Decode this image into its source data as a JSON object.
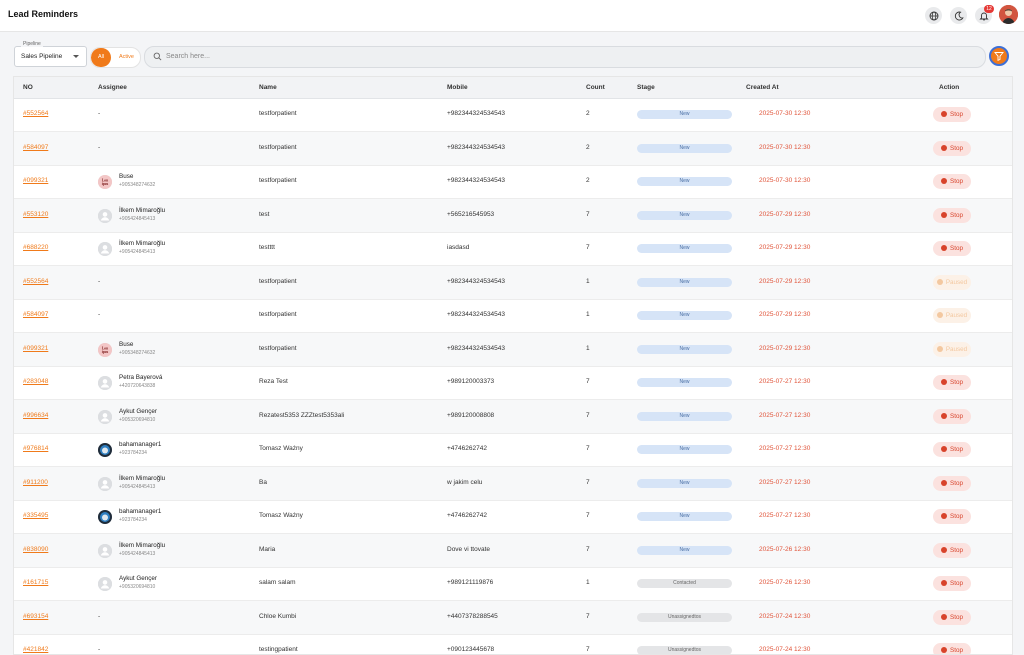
{
  "header": {
    "title": "Lead Reminders",
    "notification_count": "12"
  },
  "filters": {
    "pipeline_label": "Pipeline",
    "pipeline_value": "Sales Pipeline",
    "toggle_all": "All",
    "toggle_active": "Active",
    "search_placeholder": "Search here..."
  },
  "table": {
    "columns": {
      "no": "NO",
      "assignee": "Assignee",
      "name": "Name",
      "mobile": "Mobile",
      "count": "Count",
      "stage": "Stage",
      "created": "Created At",
      "action": "Action"
    },
    "rows": [
      {
        "no": "#552564",
        "assignee": "-",
        "name": "testforpatient",
        "mobile": "+982344324534543",
        "count": "2",
        "stage": "New",
        "created": "2025-07-30 12:30",
        "action": "Stop"
      },
      {
        "no": "#584097",
        "assignee": "-",
        "name": "testforpatient",
        "mobile": "+982344324534543",
        "count": "2",
        "stage": "New",
        "created": "2025-07-30 12:30",
        "action": "Stop"
      },
      {
        "no": "#099321",
        "assignee": "Buse",
        "phone": "+905348274632",
        "avatar": "logo",
        "name": "testforpatient",
        "mobile": "+982344324534543",
        "count": "2",
        "stage": "New",
        "created": "2025-07-30 12:30",
        "action": "Stop"
      },
      {
        "no": "#553120",
        "assignee": "İlkem Mimaroğlu",
        "phone": "+905424845413",
        "avatar": "default",
        "name": "test",
        "mobile": "+565216545953",
        "count": "7",
        "stage": "New",
        "created": "2025-07-29 12:30",
        "action": "Stop"
      },
      {
        "no": "#688220",
        "assignee": "İlkem Mimaroğlu",
        "phone": "+905424845413",
        "avatar": "default",
        "name": "testttt",
        "mobile": "iasdasd",
        "count": "7",
        "stage": "New",
        "created": "2025-07-29 12:30",
        "action": "Stop"
      },
      {
        "no": "#552564",
        "assignee": "-",
        "name": "testforpatient",
        "mobile": "+982344324534543",
        "count": "1",
        "stage": "New",
        "created": "2025-07-29 12:30",
        "action": "Paused"
      },
      {
        "no": "#584097",
        "assignee": "-",
        "name": "testforpatient",
        "mobile": "+982344324534543",
        "count": "1",
        "stage": "New",
        "created": "2025-07-29 12:30",
        "action": "Paused"
      },
      {
        "no": "#099321",
        "assignee": "Buse",
        "phone": "+905348274632",
        "avatar": "logo",
        "name": "testforpatient",
        "mobile": "+982344324534543",
        "count": "1",
        "stage": "New",
        "created": "2025-07-29 12:30",
        "action": "Paused"
      },
      {
        "no": "#283048",
        "assignee": "Petra Bayerová",
        "phone": "+420720643838",
        "avatar": "default",
        "name": "Reza Test",
        "mobile": "+989120003373",
        "count": "7",
        "stage": "New",
        "created": "2025-07-27 12:30",
        "action": "Stop"
      },
      {
        "no": "#996634",
        "assignee": "Aykut Gençer",
        "phone": "+905320694810",
        "avatar": "default",
        "name": "Rezatest5353 ZZZtest5353ali",
        "mobile": "+989120008808",
        "count": "7",
        "stage": "New",
        "created": "2025-07-27 12:30",
        "action": "Stop"
      },
      {
        "no": "#976814",
        "assignee": "bahamanager1",
        "phone": "+923784234",
        "avatar": "photo",
        "name": "Tomasz Ważny",
        "mobile": "+4746262742",
        "count": "7",
        "stage": "New",
        "created": "2025-07-27 12:30",
        "action": "Stop"
      },
      {
        "no": "#911200",
        "assignee": "İlkem Mimaroğlu",
        "phone": "+905424845413",
        "avatar": "default",
        "name": "Ba",
        "mobile": "w jakim celu",
        "count": "7",
        "stage": "New",
        "created": "2025-07-27 12:30",
        "action": "Stop"
      },
      {
        "no": "#335495",
        "assignee": "bahamanager1",
        "phone": "+923784234",
        "avatar": "photo",
        "name": "Tomasz Ważny",
        "mobile": "+4746262742",
        "count": "7",
        "stage": "New",
        "created": "2025-07-27 12:30",
        "action": "Stop"
      },
      {
        "no": "#838090",
        "assignee": "İlkem Mimaroğlu",
        "phone": "+905424845413",
        "avatar": "default",
        "name": "Maria",
        "mobile": "Dove vi ttovate",
        "count": "7",
        "stage": "New",
        "created": "2025-07-26 12:30",
        "action": "Stop"
      },
      {
        "no": "#161715",
        "assignee": "Aykut Gençer",
        "phone": "+905320694810",
        "avatar": "default",
        "name": "salam salam",
        "mobile": "+989121119876",
        "count": "1",
        "stage": "Contacted",
        "created": "2025-07-26 12:30",
        "action": "Stop"
      },
      {
        "no": "#693154",
        "assignee": "-",
        "name": "Chloe Kumbi",
        "mobile": "+4407378288545",
        "count": "7",
        "stage": "Unassignedtos",
        "created": "2025-07-24 12:30",
        "action": "Stop"
      },
      {
        "no": "#421842",
        "assignee": "-",
        "name": "testingpatient",
        "mobile": "+090123445678",
        "count": "7",
        "stage": "Unassignedtos",
        "created": "2025-07-24 12:30",
        "action": "Stop"
      }
    ]
  },
  "colors": {
    "accent": "#f07a1a",
    "stop": "#d8432b",
    "date": "#e0543a"
  }
}
